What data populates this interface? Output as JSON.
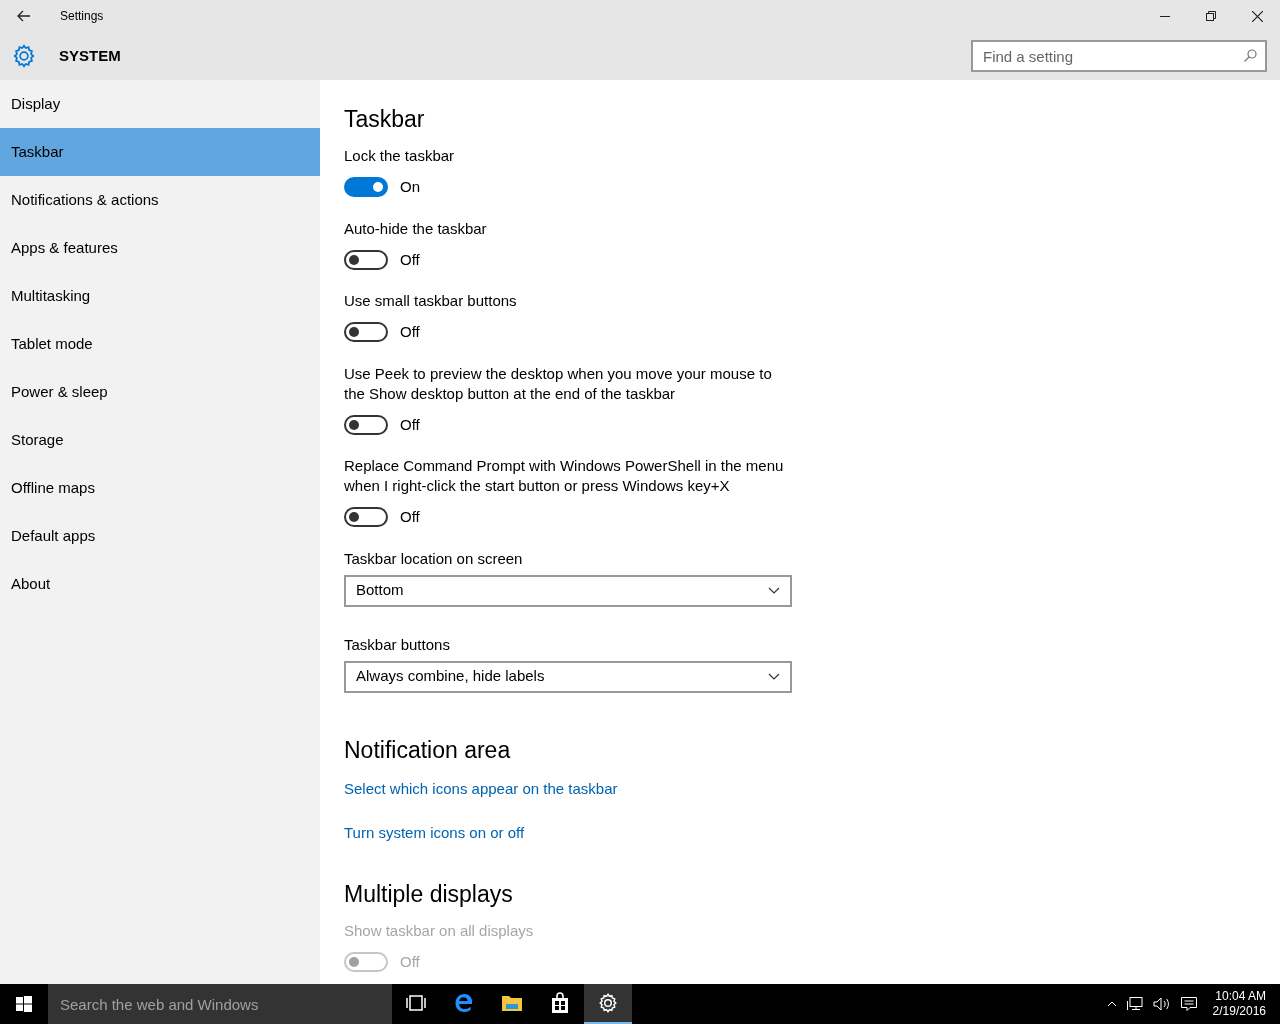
{
  "window": {
    "title": "Settings"
  },
  "header": {
    "title": "SYSTEM",
    "search": {
      "placeholder": "Find a setting"
    }
  },
  "sidebar": {
    "items": [
      {
        "label": "Display",
        "selected": false
      },
      {
        "label": "Taskbar",
        "selected": true
      },
      {
        "label": "Notifications & actions",
        "selected": false
      },
      {
        "label": "Apps & features",
        "selected": false
      },
      {
        "label": "Multitasking",
        "selected": false
      },
      {
        "label": "Tablet mode",
        "selected": false
      },
      {
        "label": "Power & sleep",
        "selected": false
      },
      {
        "label": "Storage",
        "selected": false
      },
      {
        "label": "Offline maps",
        "selected": false
      },
      {
        "label": "Default apps",
        "selected": false
      },
      {
        "label": "About",
        "selected": false
      }
    ]
  },
  "sections": [
    {
      "heading": "Taskbar",
      "items": [
        {
          "kind": "toggle",
          "label": "Lock the taskbar",
          "on": true,
          "disabled": false,
          "state_text": "On"
        },
        {
          "kind": "toggle",
          "label": "Auto-hide the taskbar",
          "on": false,
          "disabled": false,
          "state_text": "Off"
        },
        {
          "kind": "toggle",
          "label": "Use small taskbar buttons",
          "on": false,
          "disabled": false,
          "state_text": "Off"
        },
        {
          "kind": "toggle",
          "label": "Use Peek to preview the desktop when you move your mouse to the Show desktop button at the end of the taskbar",
          "on": false,
          "disabled": false,
          "state_text": "Off"
        },
        {
          "kind": "toggle",
          "label": "Replace Command Prompt with Windows PowerShell in the menu when I right-click the start button or press Windows key+X",
          "on": false,
          "disabled": false,
          "state_text": "Off"
        },
        {
          "kind": "dropdown",
          "label": "Taskbar location on screen",
          "value": "Bottom"
        },
        {
          "kind": "dropdown",
          "label": "Taskbar buttons",
          "value": "Always combine, hide labels"
        }
      ]
    },
    {
      "heading": "Notification area",
      "items": [
        {
          "kind": "link",
          "label": "Select which icons appear on the taskbar"
        },
        {
          "kind": "link",
          "label": "Turn system icons on or off"
        }
      ]
    },
    {
      "heading": "Multiple displays",
      "items": [
        {
          "kind": "toggle",
          "label": "Show taskbar on all displays",
          "on": false,
          "disabled": true,
          "state_text": "Off"
        }
      ]
    }
  ],
  "taskbar": {
    "search": {
      "placeholder": "Search the web and Windows"
    },
    "apps": [
      {
        "kind": "task-view",
        "selected": false
      },
      {
        "kind": "browser",
        "selected": false
      },
      {
        "kind": "folder",
        "selected": false
      },
      {
        "kind": "store",
        "selected": false
      },
      {
        "kind": "settings",
        "selected": true
      }
    ],
    "clock": {
      "time": "10:04 AM",
      "date": "2/19/2016"
    }
  }
}
